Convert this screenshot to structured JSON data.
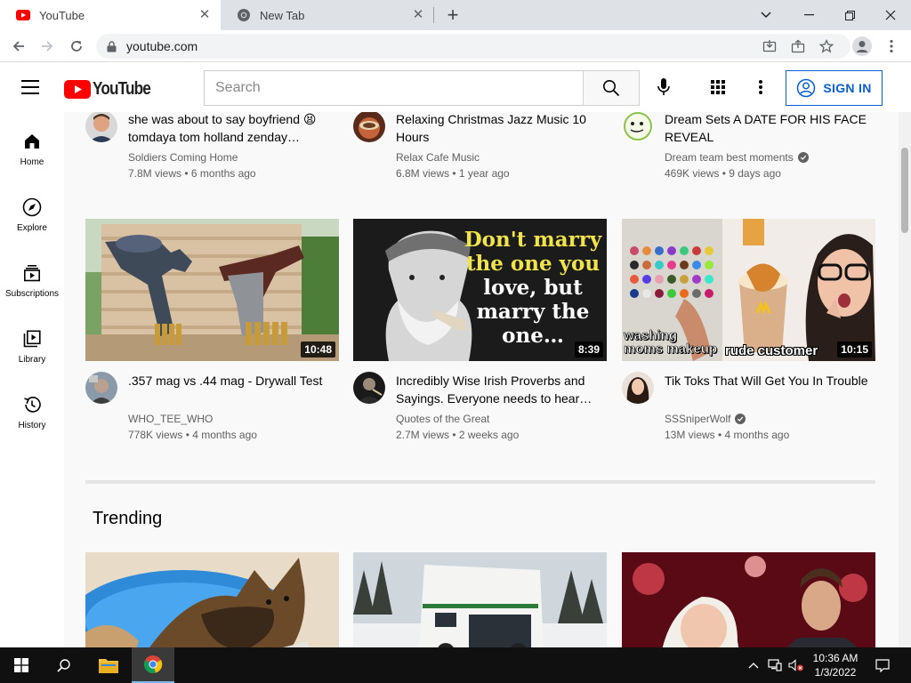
{
  "browser": {
    "tabs": [
      {
        "title": "YouTube",
        "active": true,
        "favicon": "youtube-icon"
      },
      {
        "title": "New Tab",
        "active": false,
        "favicon": "chrome-icon"
      }
    ],
    "url": "youtube.com"
  },
  "header": {
    "logo_text": "YouTube",
    "search_placeholder": "Search",
    "signin_label": "SIGN IN"
  },
  "guide": [
    {
      "label": "Home",
      "icon": "home-icon"
    },
    {
      "label": "Explore",
      "icon": "compass-icon"
    },
    {
      "label": "Subscriptions",
      "icon": "subscriptions-icon"
    },
    {
      "label": "Library",
      "icon": "library-icon"
    },
    {
      "label": "History",
      "icon": "history-icon"
    }
  ],
  "top_row": [
    {
      "title": "she was about to say boyfriend 😫 tomdaya tom holland zenday…",
      "channel": "Soldiers Coming Home",
      "stats": "7.8M views • 6 months ago",
      "verified": false
    },
    {
      "title": "Relaxing Christmas Jazz Music 10 Hours",
      "channel": "Relax Cafe Music",
      "stats": "6.8M views • 1 year ago",
      "verified": false
    },
    {
      "title": "Dream Sets A DATE FOR HIS FACE REVEAL",
      "channel": "Dream team best moments",
      "stats": "469K views • 9 days ago",
      "verified": true
    }
  ],
  "second_row": [
    {
      "title": ".357 mag vs .44 mag - Drywall Test",
      "channel": "WHO_TEE_WHO",
      "stats": "778K views • 4 months ago",
      "duration": "10:48",
      "verified": false
    },
    {
      "title": "Incredibly Wise Irish Proverbs and Sayings. Everyone needs to hear…",
      "channel": "Quotes of the Great",
      "stats": "2.7M views • 2 weeks ago",
      "duration": "8:39",
      "verified": false,
      "thumb_text": [
        "Don't marry",
        "the one you",
        "love, but",
        "marry the",
        "one…"
      ]
    },
    {
      "title": "Tik Toks That Will Get You In Trouble",
      "channel": "SSSniperWolf",
      "stats": "13M views • 4 months ago",
      "duration": "10:15",
      "verified": true,
      "thumb_text": [
        "washing",
        "moms makeup",
        "rude customer"
      ]
    }
  ],
  "trending": {
    "title": "Trending"
  },
  "taskbar": {
    "time": "10:36 AM",
    "date": "1/3/2022"
  },
  "colors": {
    "youtube_red": "#ff0000",
    "signin_blue": "#065fd4",
    "taskbar": "#101010"
  }
}
